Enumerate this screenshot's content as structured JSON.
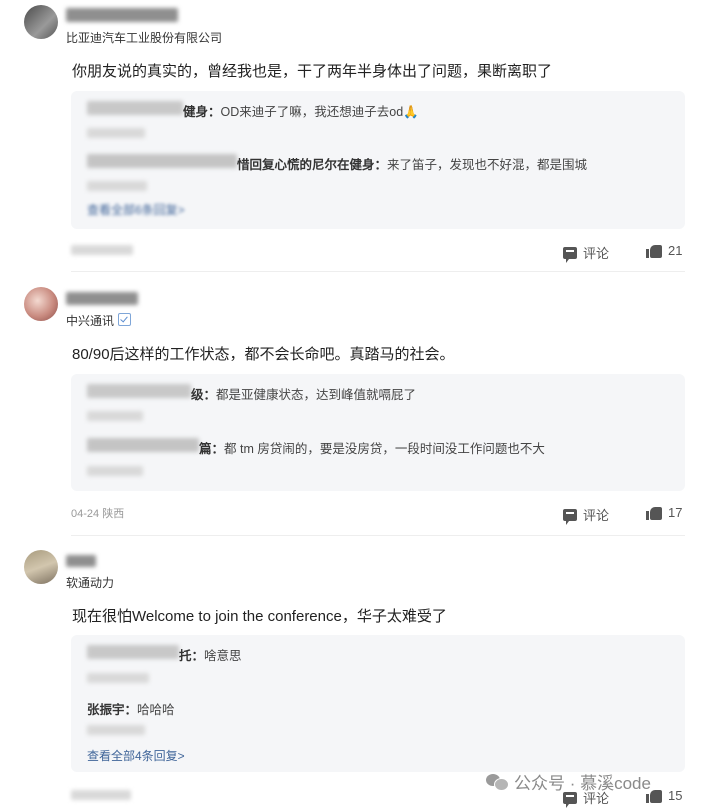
{
  "comments": [
    {
      "company": "比亚迪汽车工业股份有限公司",
      "text": "你朋友说的真实的，曾经我也是，干了两年半身体出了问题，果断离职了",
      "replies": [
        {
          "author_suffix": "健身：",
          "text": "OD来迪子了嘛，我还想迪子去od🙏"
        },
        {
          "author_suffix": "惜回复心慌的尼尔在健身：",
          "text": "来了笛子，发现也不好混，都是围城"
        }
      ],
      "more": "查看全部6条回复>",
      "meta": "",
      "comment_label": "评论",
      "likes": "21"
    },
    {
      "company": "中兴通讯",
      "text": "80/90后这样的工作状态，都不会长命吧。真踏马的社会。",
      "replies": [
        {
          "author_suffix": "级：",
          "text": "都是亚健康状态，达到峰值就嗝屁了"
        },
        {
          "author_suffix": "篇：",
          "text": "都 tm 房贷闹的，要是没房贷，一段时间没工作问题也不大"
        }
      ],
      "more": "",
      "meta": "04-24 陕西",
      "comment_label": "评论",
      "likes": "17"
    },
    {
      "company": "软通动力",
      "text": "现在很怕Welcome to join the conference，华子太难受了",
      "replies": [
        {
          "author_suffix": "托：",
          "text": "啥意思"
        },
        {
          "author_suffix": "张振宇：",
          "text": "哈哈哈"
        }
      ],
      "more": "查看全部4条回复>",
      "meta": "",
      "comment_label": "评论",
      "likes": "15"
    }
  ],
  "watermark": "公众号 · 慕溪code"
}
